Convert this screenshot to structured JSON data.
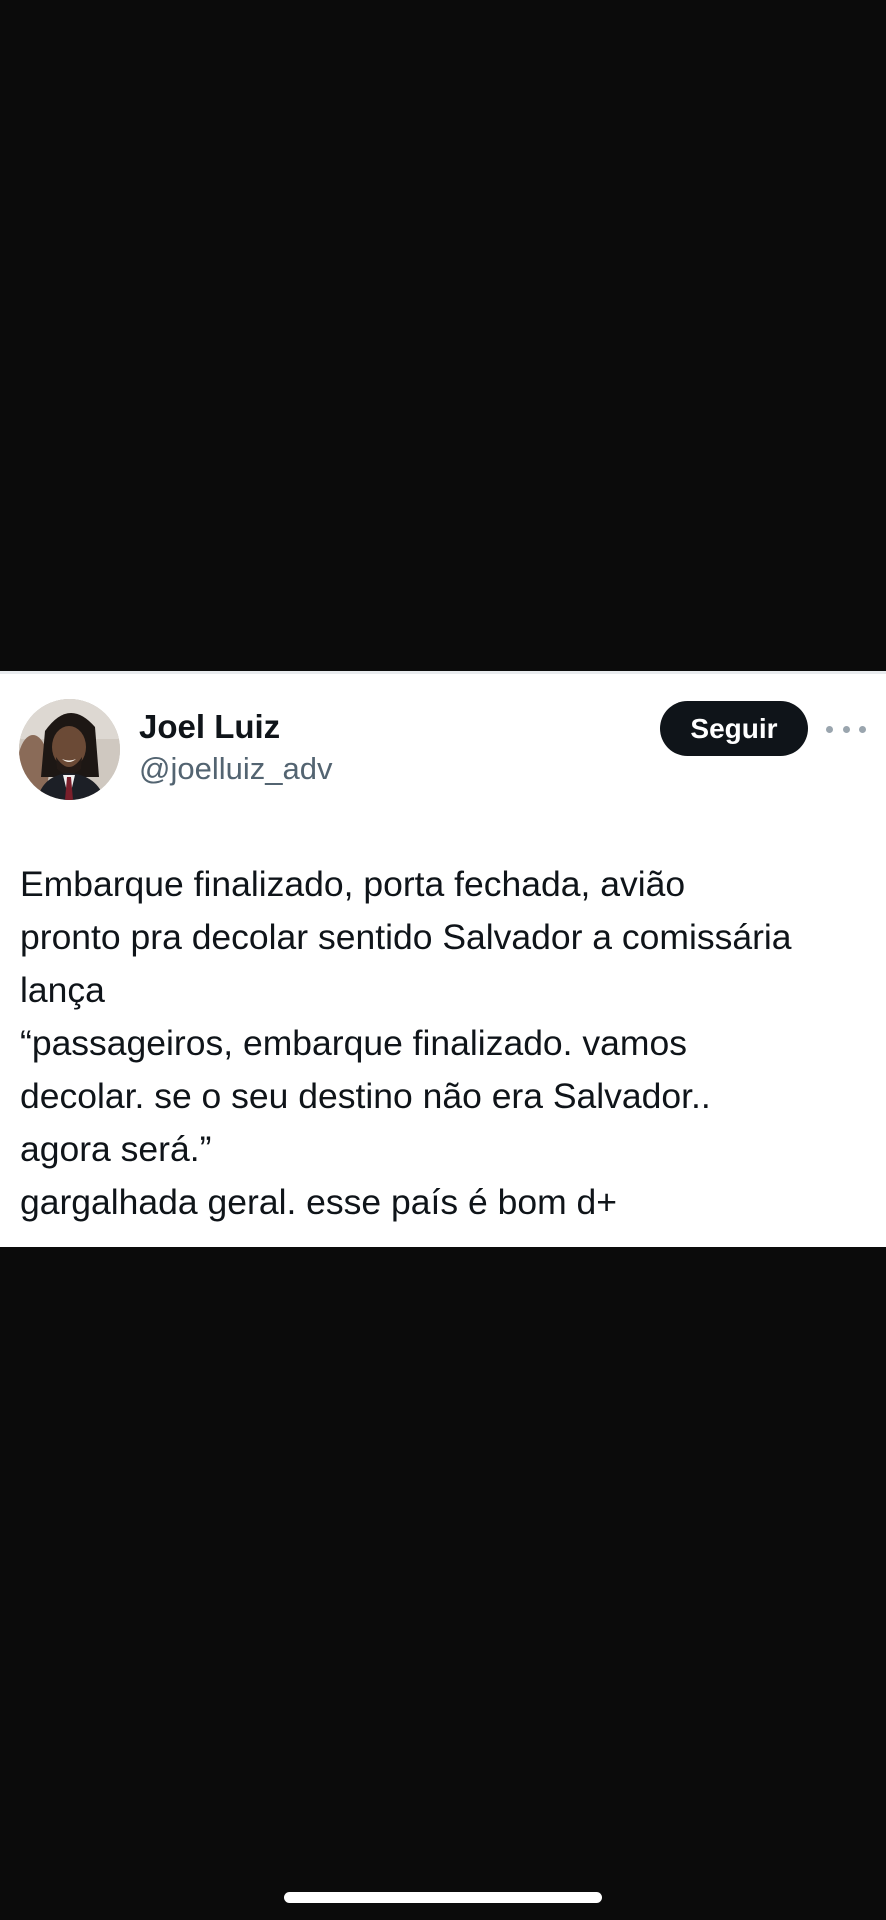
{
  "tweet": {
    "author": {
      "display_name": "Joel Luiz",
      "handle": "@joelluiz_adv"
    },
    "follow_label": "Seguir",
    "more_icon": "more-horizontal-icon",
    "text_lines": [
      "Embarque finalizado, porta fechada, avião",
      "pronto pra decolar sentido Salvador a comissária",
      "lança",
      "“passageiros, embarque finalizado. vamos",
      "decolar. se o seu destino não era Salvador..",
      "agora será.”",
      "gargalhada geral. esse país é bom d+"
    ]
  },
  "colors": {
    "page_background": "#0b0b0b",
    "card_background": "#ffffff",
    "text_primary": "#0f1419",
    "text_secondary": "#536471",
    "button_background": "#0f1419"
  }
}
